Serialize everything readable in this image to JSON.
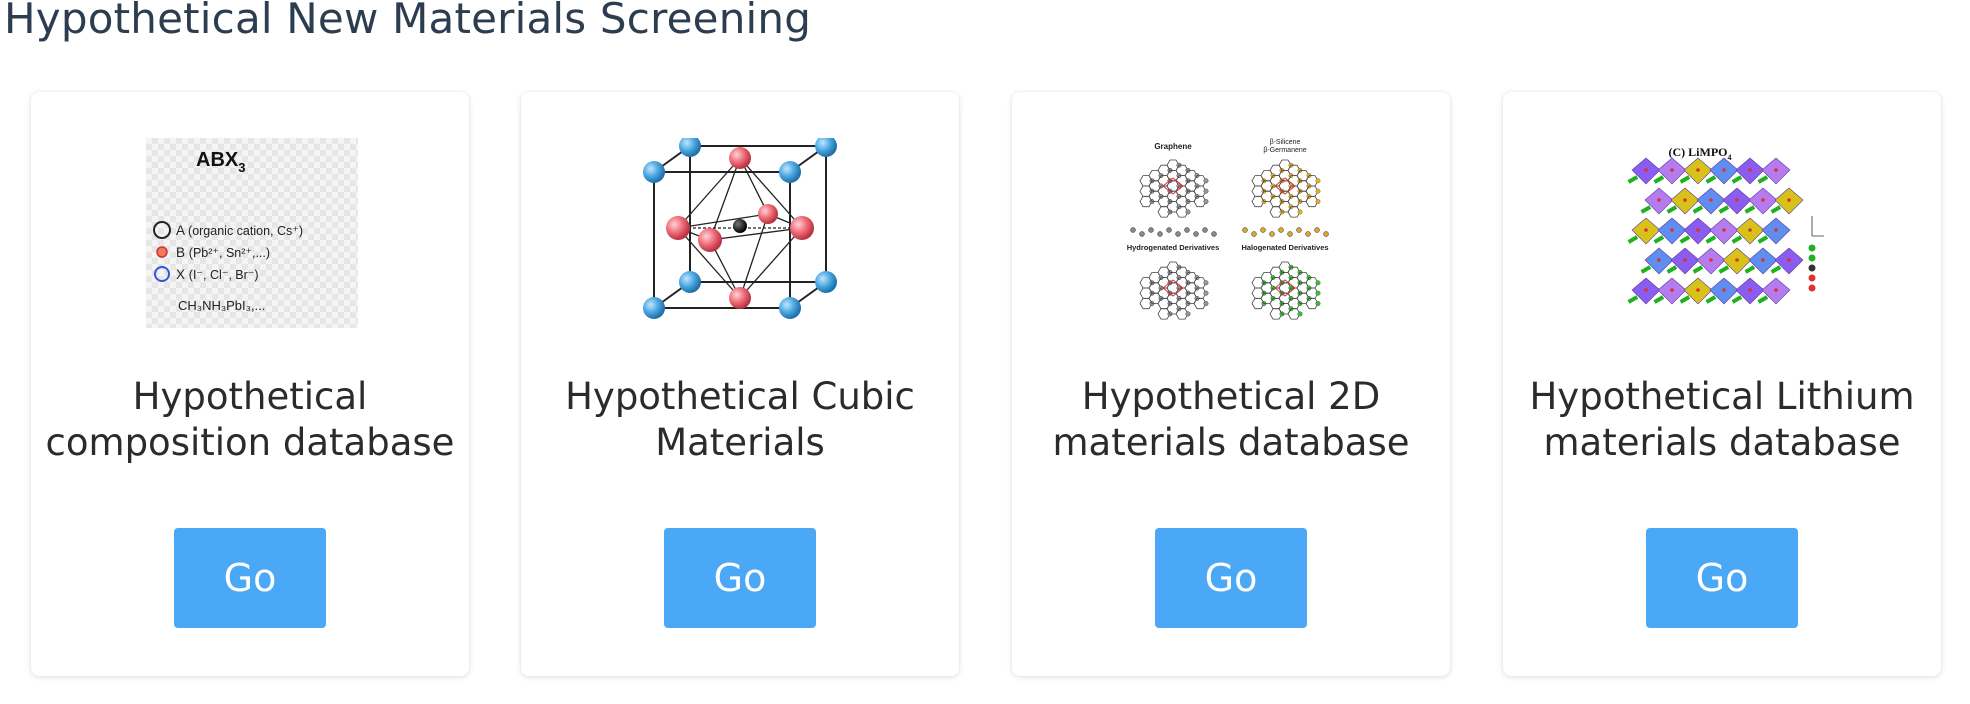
{
  "page": {
    "title": "Hypothetical New Materials Screening"
  },
  "cards": [
    {
      "title": "Hypothetical composition database",
      "button": "Go",
      "figure": {
        "formula": "ABX",
        "formula_sub": "3",
        "legend": [
          {
            "symbol": "A",
            "desc": "(organic cation, Cs⁺)"
          },
          {
            "symbol": "B",
            "desc": "(Pb²⁺, Sn²⁺,...)"
          },
          {
            "symbol": "X",
            "desc": "(I⁻, Cl⁻, Br⁻)"
          }
        ],
        "example": "CH₃NH₃PbI₃,..."
      }
    },
    {
      "title": "Hypothetical Cubic Materials",
      "button": "Go",
      "figure": {}
    },
    {
      "title": "Hypothetical 2D materials database",
      "button": "Go",
      "figure": {
        "labels": [
          "Graphene",
          "β-Silicene",
          "β-Germanene",
          "Hydrogenated Derivatives",
          "Halogenated Derivatives"
        ]
      }
    },
    {
      "title": "Hypothetical Lithium materials database",
      "button": "Go",
      "figure": {
        "caption": "(C) LiMPO",
        "caption_sub": "4"
      }
    }
  ],
  "colors": {
    "button_bg": "#4aa8f6",
    "title": "#2d3d50"
  }
}
